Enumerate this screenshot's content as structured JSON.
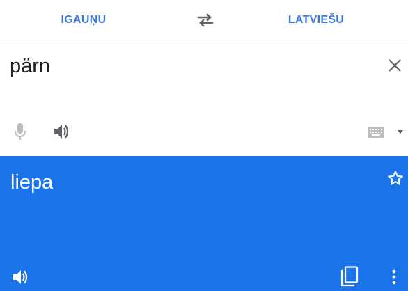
{
  "language_bar": {
    "source_language": "IGAUŅU",
    "target_language": "LATVIEŠU",
    "swap_icon": "swap-arrows-icon"
  },
  "input": {
    "text": "pärn",
    "clear_icon": "close-icon",
    "mic_icon": "microphone-icon",
    "speak_icon": "volume-icon",
    "keyboard_icon": "keyboard-icon"
  },
  "result": {
    "text": "liepa",
    "star_icon": "star-outline-icon",
    "speak_icon": "volume-icon",
    "copy_icon": "copy-icon",
    "more_icon": "more-vertical-icon"
  },
  "colors": {
    "accent_text": "#3d7ae0",
    "result_background": "#1a73e8",
    "icon_gray": "#5f6368",
    "icon_disabled": "#bdbdbd"
  }
}
